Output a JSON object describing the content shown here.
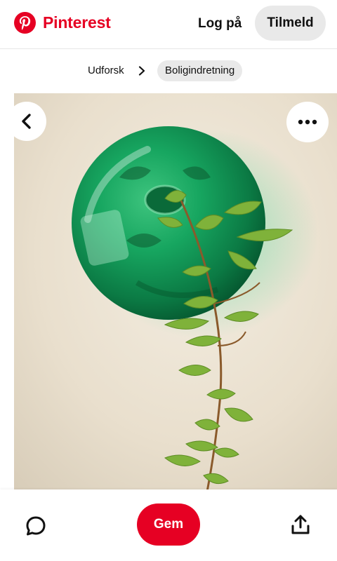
{
  "header": {
    "brand": "Pinterest",
    "login_label": "Log på",
    "signup_label": "Tilmeld"
  },
  "breadcrumb": {
    "explore": "Udforsk",
    "current": "Boligindretning"
  },
  "pin": {
    "image_subject": "green glass bubble vase on wall with vine branch",
    "icons": {
      "back": "chevron-left-icon",
      "more": "ellipsis-icon",
      "comment": "comment-icon",
      "share": "share-icon"
    }
  },
  "actions": {
    "save_label": "Gem"
  },
  "colors": {
    "brand_red": "#e60023",
    "pill_gray": "#e9e9e9",
    "text": "#111111"
  }
}
